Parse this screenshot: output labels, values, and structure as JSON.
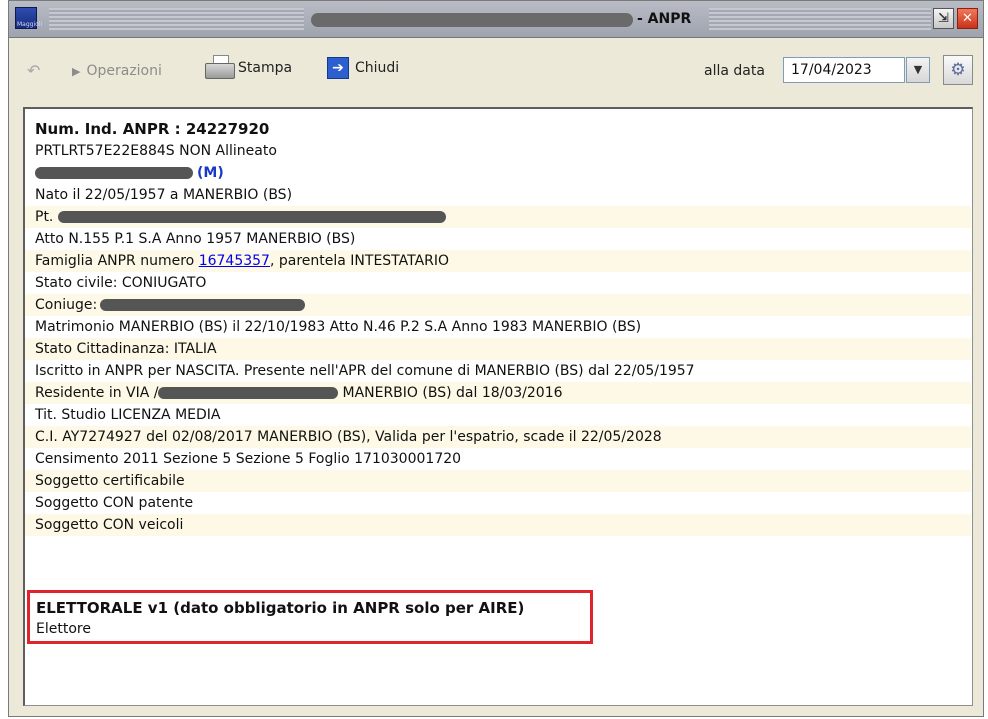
{
  "window": {
    "title_suffix": "- ANPR",
    "restore_label": "⇲",
    "close_label": "✕",
    "app_icon_label": "Maggioli"
  },
  "toolbar": {
    "operazioni": "Operazioni",
    "stampa": "Stampa",
    "chiudi": "Chiudi",
    "alla_data": "alla data",
    "date_value": "17/04/2023"
  },
  "record": {
    "header": "Num. Ind. ANPR : 24227920",
    "fiscal_code_status": "PRTLRT57E22E884S NON Allineato",
    "sex": "(M)",
    "birth": "Nato il 22/05/1957 a MANERBIO (BS)",
    "pt_label": "Pt.",
    "atto": "Atto N.155 P.1 S.A Anno 1957 MANERBIO (BS)",
    "famiglia_prefix": "Famiglia ANPR numero ",
    "famiglia_number": "16745357",
    "famiglia_suffix": ", parentela INTESTATARIO",
    "stato_civile": "Stato civile: CONIUGATO",
    "coniuge_label": "Coniuge:",
    "matrimonio": "Matrimonio MANERBIO (BS) il 22/10/1983 Atto N.46 P.2 S.A Anno 1983 MANERBIO (BS)",
    "cittadinanza": "Stato Cittadinanza: ITALIA",
    "iscritto": "Iscritto in ANPR per NASCITA. Presente nell'APR del comune di MANERBIO (BS) dal 22/05/1957",
    "residente_prefix": "Residente in VIA /",
    "residente_suffix": "MANERBIO (BS) dal 18/03/2016",
    "titolo_studio": "Tit. Studio LICENZA MEDIA",
    "carta_identita": "C.I. AY7274927 del 02/08/2017 MANERBIO (BS), Valida per l'espatrio, scade il 22/05/2028",
    "censimento": "Censimento 2011 Sezione 5 Sezione 5 Foglio 171030001720",
    "certificabile": "Soggetto certificabile",
    "patente": "Soggetto CON patente",
    "veicoli": "Soggetto CON veicoli"
  },
  "elettorale": {
    "title": "ELETTORALE v1 (dato obbligatorio in ANPR solo per AIRE)",
    "value": "Elettore"
  },
  "colors": {
    "highlight_border": "#e0242e",
    "link": "#0000ee",
    "sex_marker": "#1a38c8",
    "row_alt": "#fdf9e6"
  }
}
